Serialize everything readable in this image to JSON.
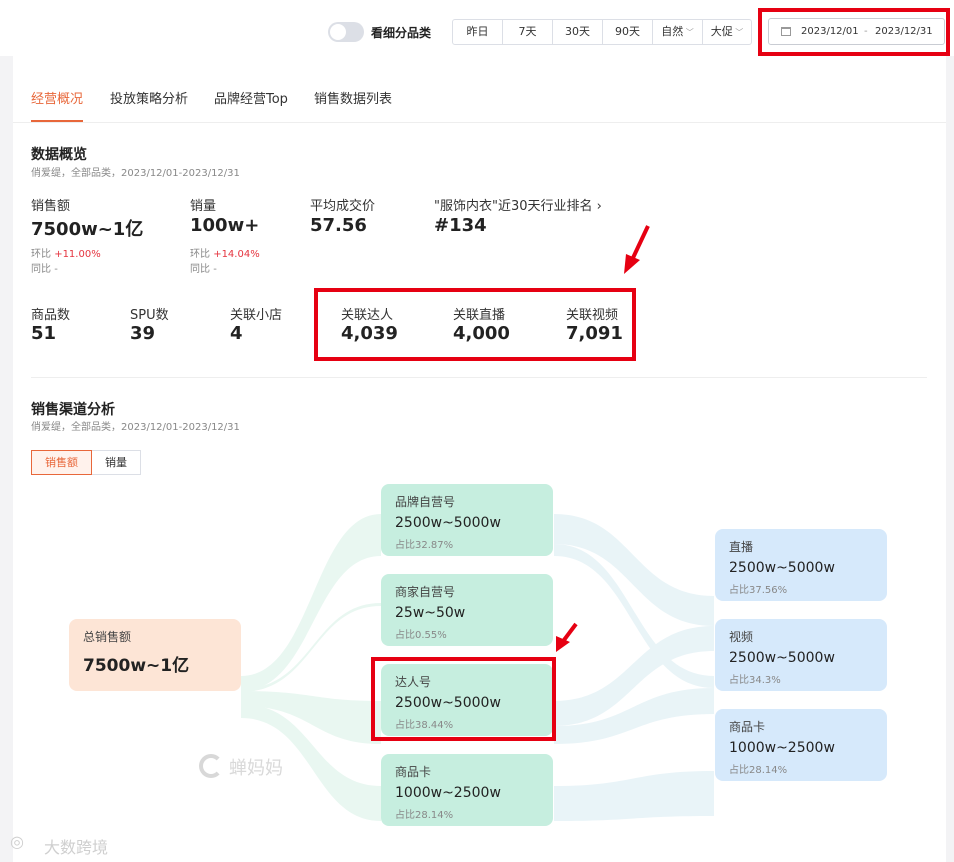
{
  "topbar": {
    "toggle_label": "看细分品类",
    "ranges": [
      "昨日",
      "7天",
      "30天",
      "90天"
    ],
    "dropdowns": [
      "自然",
      "大促"
    ],
    "date_start": "2023/12/01",
    "date_end": "2023/12/31",
    "date_sep": "-"
  },
  "tabs": [
    "经营概况",
    "投放策略分析",
    "品牌经营Top",
    "销售数据列表"
  ],
  "overview": {
    "title": "数据概览",
    "subtitle": "俏爱缇，全部品类，2023/12/01-2023/12/31",
    "sales_label": "销售额",
    "sales_value": "7500w~1亿",
    "sales_mom_label": "环比",
    "sales_mom": "+11.00%",
    "sales_yoy_label": "同比",
    "sales_yoy": "-",
    "volume_label": "销量",
    "volume_value": "100w+",
    "volume_mom_label": "环比",
    "volume_mom": "+14.04%",
    "volume_yoy_label": "同比",
    "volume_yoy": "-",
    "avg_price_label": "平均成交价",
    "avg_price_value": "57.56",
    "rank_label": "\"服饰内衣\"近30天行业排名",
    "rank_chevron": "›",
    "rank_value": "#134",
    "products_label": "商品数",
    "products_value": "51",
    "spu_label": "SPU数",
    "spu_value": "39",
    "shops_label": "关联小店",
    "shops_value": "4",
    "influencers_label": "关联达人",
    "influencers_value": "4,039",
    "lives_label": "关联直播",
    "lives_value": "4,000",
    "videos_label": "关联视频",
    "videos_value": "7,091"
  },
  "channel": {
    "title": "销售渠道分析",
    "subtitle": "俏爱缇，全部品类，2023/12/01-2023/12/31",
    "seg_sales": "销售额",
    "seg_volume": "销量",
    "total": {
      "name": "总销售额",
      "value": "7500w~1亿"
    },
    "sources": [
      {
        "name": "品牌自营号",
        "value": "2500w~5000w",
        "share": "占比32.87%"
      },
      {
        "name": "商家自营号",
        "value": "25w~50w",
        "share": "占比0.55%"
      },
      {
        "name": "达人号",
        "value": "2500w~5000w",
        "share": "占比38.44%"
      },
      {
        "name": "商品卡",
        "value": "1000w~2500w",
        "share": "占比28.14%"
      }
    ],
    "targets": [
      {
        "name": "直播",
        "value": "2500w~5000w",
        "share": "占比37.56%"
      },
      {
        "name": "视频",
        "value": "2500w~5000w",
        "share": "占比34.3%"
      },
      {
        "name": "商品卡",
        "value": "1000w~2500w",
        "share": "占比28.14%"
      }
    ]
  },
  "watermarks": {
    "center": "蝉妈妈",
    "corner": "大数跨境"
  },
  "colors": {
    "accent": "#e8673a",
    "highlight": "#e60012",
    "up": "#e5343f",
    "green_node": "#c6eedf",
    "blue_node": "#d6e9fb",
    "peach_node": "#fde5d6"
  }
}
